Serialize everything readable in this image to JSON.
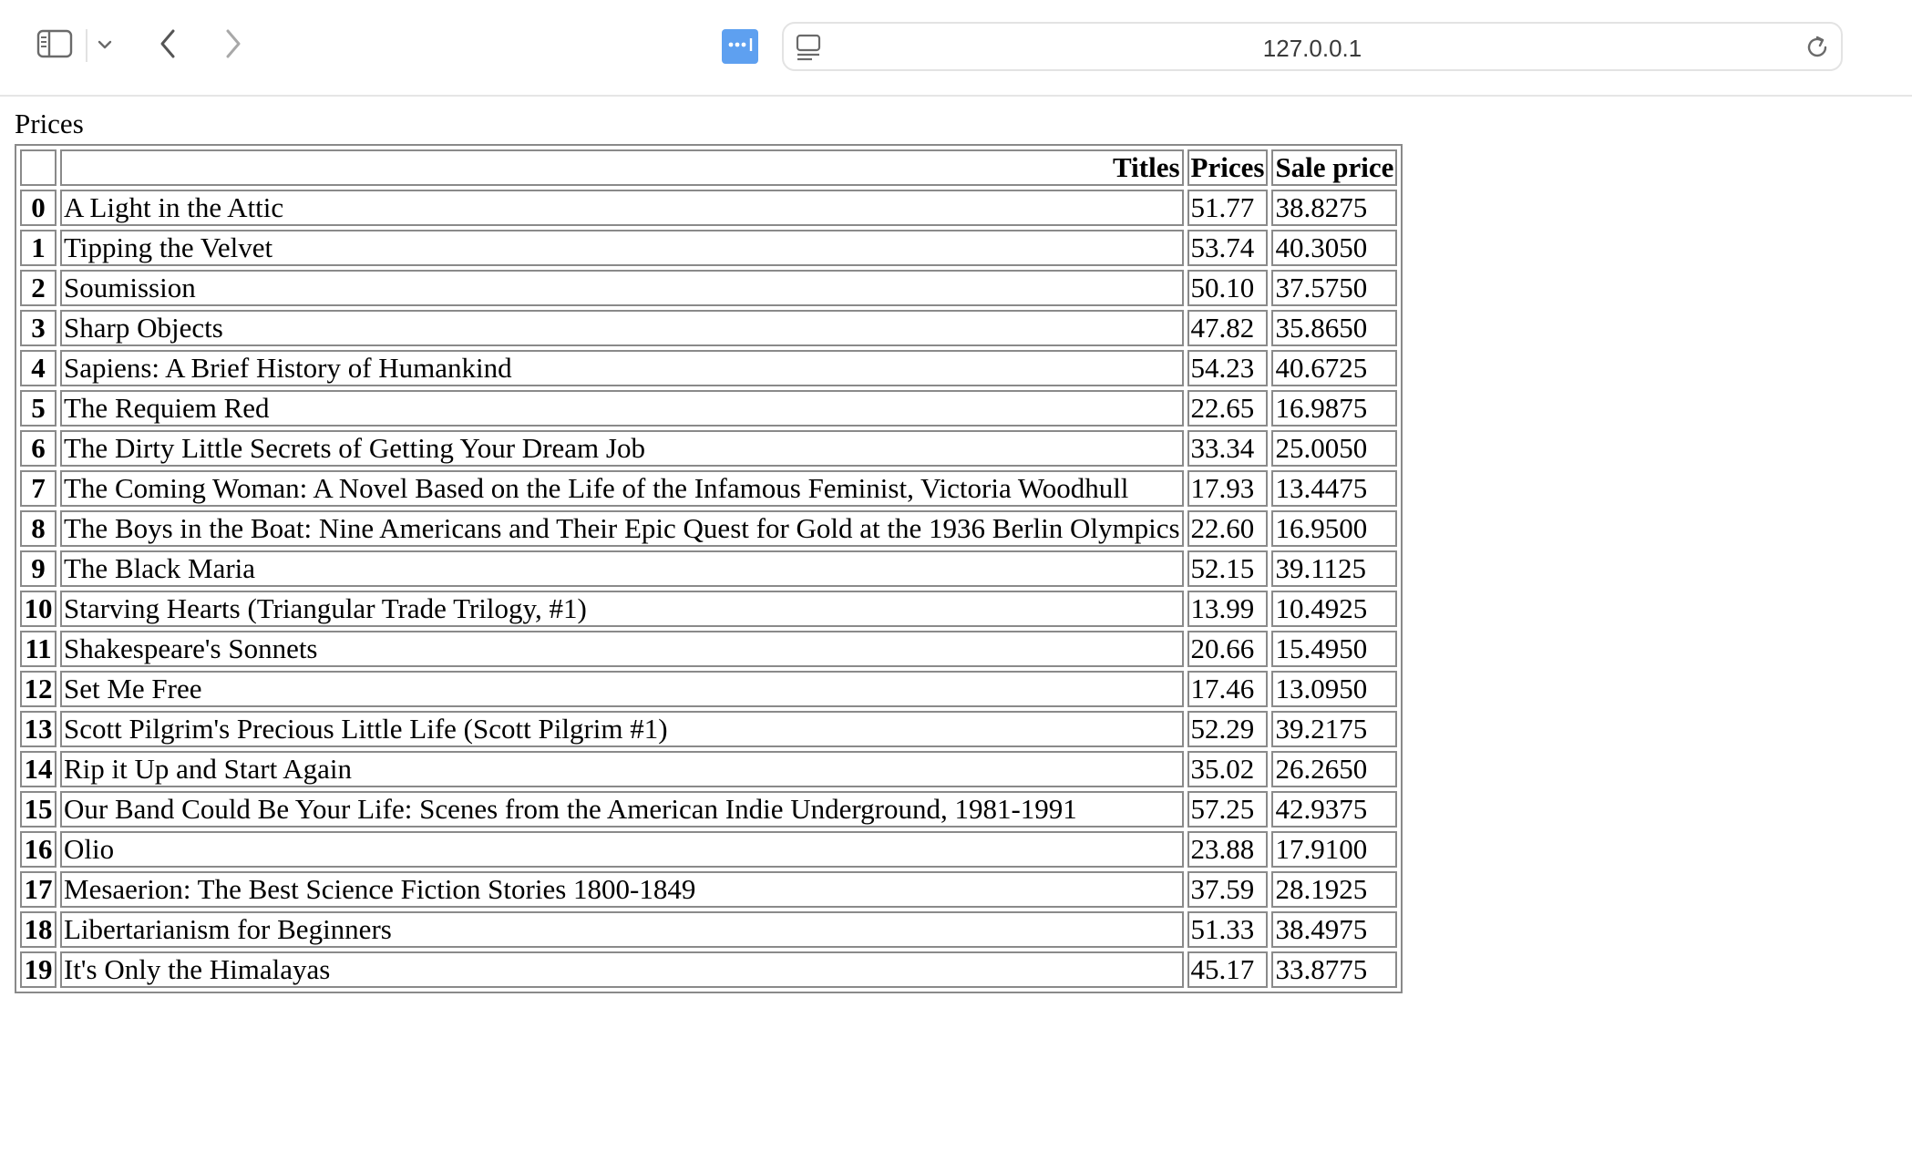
{
  "browser": {
    "url": "127.0.0.1",
    "icons": {
      "sidebar": "sidebar-icon",
      "sidebar_menu": "chevron-down-icon",
      "back": "chevron-left-icon",
      "forward": "chevron-right-icon",
      "extension": "extension-dots-icon",
      "reader": "reader-mode-icon",
      "reload": "reload-icon"
    },
    "accent_color": "#5ea0f0"
  },
  "page": {
    "caption": "Prices",
    "table": {
      "headers": [
        "",
        "Titles",
        "Prices",
        "Sale price"
      ],
      "rows": [
        {
          "index": "0",
          "title": "A Light in the Attic",
          "price": "51.77",
          "sale": "38.8275"
        },
        {
          "index": "1",
          "title": "Tipping the Velvet",
          "price": "53.74",
          "sale": "40.3050"
        },
        {
          "index": "2",
          "title": "Soumission",
          "price": "50.10",
          "sale": "37.5750"
        },
        {
          "index": "3",
          "title": "Sharp Objects",
          "price": "47.82",
          "sale": "35.8650"
        },
        {
          "index": "4",
          "title": "Sapiens: A Brief History of Humankind",
          "price": "54.23",
          "sale": "40.6725"
        },
        {
          "index": "5",
          "title": "The Requiem Red",
          "price": "22.65",
          "sale": "16.9875"
        },
        {
          "index": "6",
          "title": "The Dirty Little Secrets of Getting Your Dream Job",
          "price": "33.34",
          "sale": "25.0050"
        },
        {
          "index": "7",
          "title": "The Coming Woman: A Novel Based on the Life of the Infamous Feminist, Victoria Woodhull",
          "price": "17.93",
          "sale": "13.4475"
        },
        {
          "index": "8",
          "title": "The Boys in the Boat: Nine Americans and Their Epic Quest for Gold at the 1936 Berlin Olympics",
          "price": "22.60",
          "sale": "16.9500"
        },
        {
          "index": "9",
          "title": "The Black Maria",
          "price": "52.15",
          "sale": "39.1125"
        },
        {
          "index": "10",
          "title": "Starving Hearts (Triangular Trade Trilogy, #1)",
          "price": "13.99",
          "sale": "10.4925"
        },
        {
          "index": "11",
          "title": "Shakespeare's Sonnets",
          "price": "20.66",
          "sale": "15.4950"
        },
        {
          "index": "12",
          "title": "Set Me Free",
          "price": "17.46",
          "sale": "13.0950"
        },
        {
          "index": "13",
          "title": "Scott Pilgrim's Precious Little Life (Scott Pilgrim #1)",
          "price": "52.29",
          "sale": "39.2175"
        },
        {
          "index": "14",
          "title": "Rip it Up and Start Again",
          "price": "35.02",
          "sale": "26.2650"
        },
        {
          "index": "15",
          "title": "Our Band Could Be Your Life: Scenes from the American Indie Underground, 1981-1991",
          "price": "57.25",
          "sale": "42.9375"
        },
        {
          "index": "16",
          "title": "Olio",
          "price": "23.88",
          "sale": "17.9100"
        },
        {
          "index": "17",
          "title": "Mesaerion: The Best Science Fiction Stories 1800-1849",
          "price": "37.59",
          "sale": "28.1925"
        },
        {
          "index": "18",
          "title": "Libertarianism for Beginners",
          "price": "51.33",
          "sale": "38.4975"
        },
        {
          "index": "19",
          "title": "It's Only the Himalayas",
          "price": "45.17",
          "sale": "33.8775"
        }
      ]
    }
  }
}
